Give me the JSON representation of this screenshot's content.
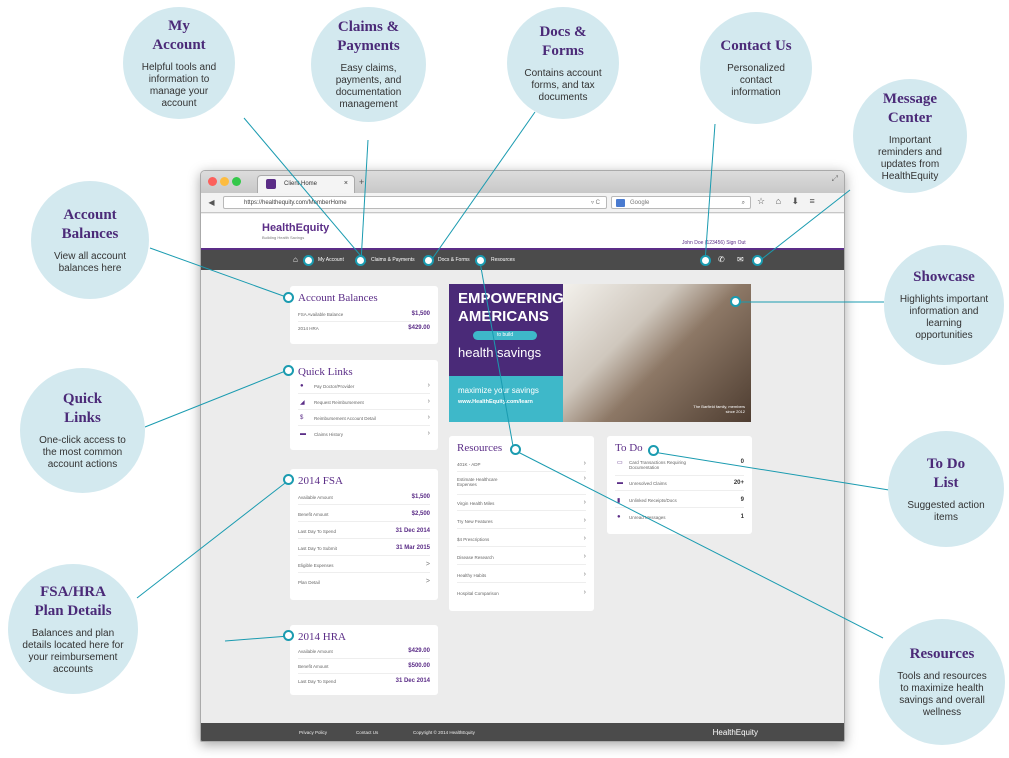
{
  "callouts": [
    {
      "title": "My\nAccount",
      "desc": "Helpful tools and information to manage your account"
    },
    {
      "title": "Claims &\nPayments",
      "desc": "Easy claims, payments, and documentation management"
    },
    {
      "title": "Docs &\nForms",
      "desc": "Contains account forms, and tax documents"
    },
    {
      "title": "Contact Us",
      "desc": "Personalized contact information"
    },
    {
      "title": "Message\nCenter",
      "desc": "Important reminders and updates from HealthEquity"
    },
    {
      "title": "Account\nBalances",
      "desc": "View all account balances here"
    },
    {
      "title": "Showcase",
      "desc": "Highlights important information and learning opportunities"
    },
    {
      "title": "Quick\nLinks",
      "desc": "One-click access to the most common account actions"
    },
    {
      "title": "To Do\nList",
      "desc": "Suggested action items"
    },
    {
      "title": "FSA/HRA\nPlan Details",
      "desc": "Balances and plan details located here for your reimbursement accounts"
    },
    {
      "title": "Resources",
      "desc": "Tools and resources to maximize health savings and overall wellness"
    }
  ],
  "browser": {
    "tab_title": "Client Home",
    "url": "https://healthequity.com/MemberHome",
    "search_placeholder": "Google",
    "colors": {
      "close": "#fc605c",
      "minimize": "#fdbc40",
      "zoom": "#34c84a"
    }
  },
  "site": {
    "logo": "HealthEquity",
    "tagline": "Building Health Savings",
    "user_line": "John Doe (123456)   Sign Out",
    "nav": [
      "My Account",
      "Claims & Payments",
      "Docs & Forms",
      "Resources"
    ],
    "brand_color": "#5b2d87",
    "accent_color": "#1a9bb0"
  },
  "account_balances": {
    "title": "Account Balances",
    "rows": [
      {
        "label": "FSA Available Balance",
        "value": "$1,500"
      },
      {
        "label": "2014 HRA",
        "value": "$429.00"
      }
    ]
  },
  "quick_links": {
    "title": "Quick Links",
    "items": [
      {
        "icon": "pay-provider-icon",
        "label": "Pay Doctor/Provider"
      },
      {
        "icon": "request-reimbursement-icon",
        "label": "Request Reimbursement"
      },
      {
        "icon": "reimbursement-detail-icon",
        "label": "Reimbursement Account Detail"
      },
      {
        "icon": "claims-history-icon",
        "label": "Claims History"
      }
    ]
  },
  "fsa": {
    "title": "2014 FSA",
    "rows": [
      {
        "label": "Available Amount",
        "value": "$1,500"
      },
      {
        "label": "Benefit Amount",
        "value": "$2,500"
      },
      {
        "label": "Last Day To Spend",
        "value": "31 Dec 2014"
      },
      {
        "label": "Last Day To Submit",
        "value": "31 Mar 2015"
      },
      {
        "label": "Eligible Expenses",
        "value": ">"
      },
      {
        "label": "Plan Detail",
        "value": ">"
      }
    ]
  },
  "hra": {
    "title": "2014 HRA",
    "rows": [
      {
        "label": "Available Amount",
        "value": "$429.00"
      },
      {
        "label": "Benefit Amount",
        "value": "$500.00"
      },
      {
        "label": "Last Day To Spend",
        "value": "31 Dec 2014"
      }
    ]
  },
  "showcase": {
    "line1": "EMPOWERING",
    "line2": "AMERICANS",
    "pill": "to build",
    "line3": "health savings",
    "line4": "maximize your savings",
    "url": "www.HealthEquity.com/learn",
    "credit": "The Barfield family, members since 2012"
  },
  "resources": {
    "title": "Resources",
    "items": [
      "401K - ADP",
      "Estimate Healthcare Expenses",
      "Virgin Health Miles",
      "Try New Features",
      "$4 Prescriptions",
      "Disease Research",
      "Healthy Habits",
      "Hospital Comparison"
    ]
  },
  "todo": {
    "title": "To Do",
    "items": [
      {
        "icon": "card-icon",
        "label": "Card Transactions Requiring Documentation",
        "count": "0"
      },
      {
        "icon": "folder-icon",
        "label": "Unresolved Claims",
        "count": "20+"
      },
      {
        "icon": "receipt-icon",
        "label": "Unlinked Receipts/Docs",
        "count": "9"
      },
      {
        "icon": "message-icon",
        "label": "Unread Messages",
        "count": "1"
      }
    ]
  },
  "footer": {
    "privacy": "Privacy Policy",
    "contact": "Contact Us",
    "copyright": "Copyright © 2014 HealthEquity",
    "logo": "HealthEquity"
  }
}
